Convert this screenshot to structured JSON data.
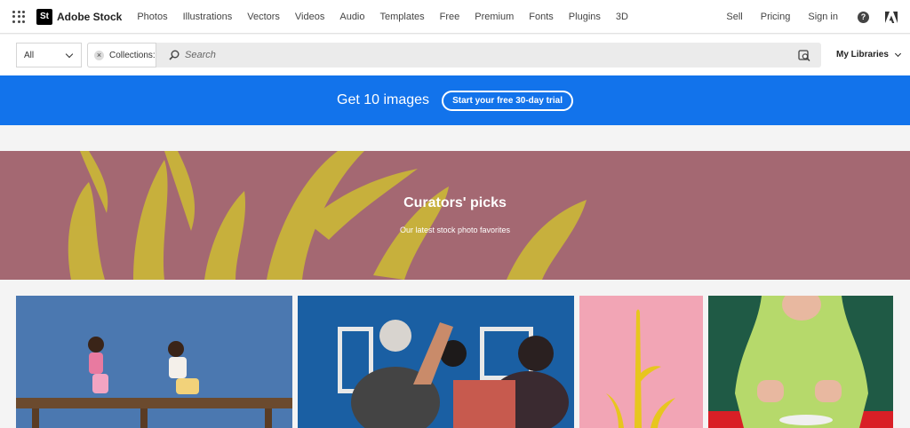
{
  "brand": {
    "badge": "St",
    "name": "Adobe Stock"
  },
  "nav": {
    "links": [
      "Photos",
      "Illustrations",
      "Vectors",
      "Videos",
      "Audio",
      "Templates",
      "Free",
      "Premium",
      "Fonts",
      "Plugins",
      "3D"
    ],
    "right_links": [
      "Sell",
      "Pricing",
      "Sign in"
    ],
    "help_glyph": "?"
  },
  "search": {
    "filter_value": "All",
    "chip_label": "Collections:",
    "chip_close": "×",
    "placeholder": "Search",
    "my_libraries": "My Libraries"
  },
  "promo": {
    "text": "Get 10 images",
    "button": "Start your free 30-day trial",
    "color": "#1273eb"
  },
  "hero": {
    "title": "Curators' picks",
    "subtitle": "Our latest stock photo favorites",
    "color": "#a46872"
  },
  "icons": [
    "apps-grid-icon",
    "search-icon",
    "visual-search-icon",
    "help-icon",
    "adobe-icon",
    "chevron-down-icon",
    "close-icon"
  ]
}
